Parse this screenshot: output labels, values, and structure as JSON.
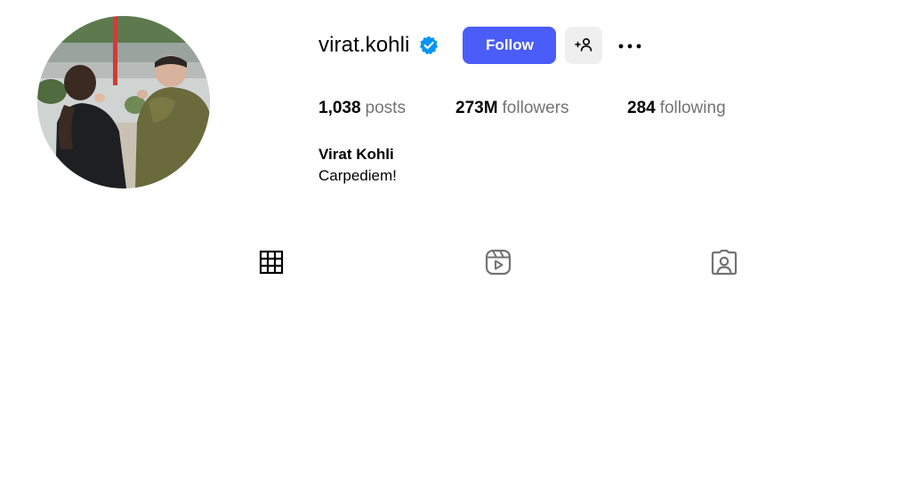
{
  "profile": {
    "username": "virat.kohli",
    "verified": true,
    "follow_label": "Follow",
    "full_name": "Virat Kohli",
    "bio": "Carpediem!"
  },
  "stats": {
    "posts_count": "1,038",
    "posts_label": "posts",
    "followers_count": "273M",
    "followers_label": "followers",
    "following_count": "284",
    "following_label": "following"
  },
  "tabs": [
    {
      "icon": "grid-icon",
      "selected": true
    },
    {
      "icon": "reels-icon",
      "selected": false
    },
    {
      "icon": "tagged-icon",
      "selected": false
    }
  ],
  "colors": {
    "follow_button": "#4a5df9",
    "verified_badge": "#0095f6",
    "secondary_text": "#737373",
    "add_user_button_bg": "#efefef"
  }
}
